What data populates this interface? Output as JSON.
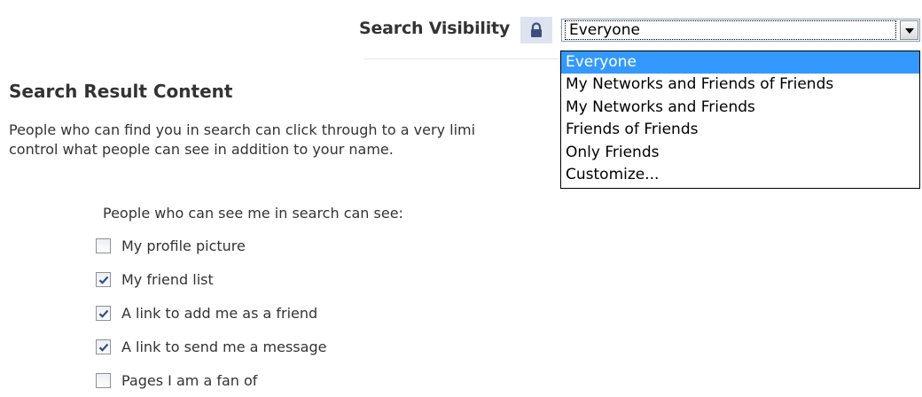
{
  "visibility": {
    "label": "Search Visibility",
    "lock_icon": "lock-icon",
    "selected": "Everyone",
    "options": [
      "Everyone",
      "My Networks and Friends of Friends",
      "My Networks and Friends",
      "Friends of Friends",
      "Only Friends",
      "Customize..."
    ],
    "highlight_color": "#3399ff"
  },
  "content": {
    "heading": "Search Result Content",
    "description_line1": "People who can find you in search can click through to a very limi",
    "description_line2": "control what people can see in addition to your name.",
    "sub_label": "People who can see me in search can see:",
    "checkboxes": [
      {
        "label": "My profile picture",
        "checked": false
      },
      {
        "label": "My friend list",
        "checked": true
      },
      {
        "label": "A link to add me as a friend",
        "checked": true
      },
      {
        "label": "A link to send me a message",
        "checked": true
      },
      {
        "label": "Pages I am a fan of",
        "checked": false
      }
    ]
  }
}
